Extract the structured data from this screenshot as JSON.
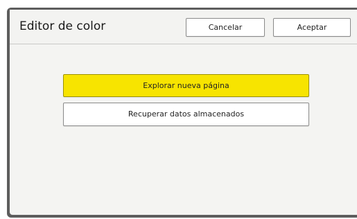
{
  "dialog": {
    "title": "Editor de color",
    "cancel_label": "Cancelar",
    "accept_label": "Aceptar"
  },
  "options": {
    "explore_label": "Explorar nueva página",
    "recover_label": "Recuperar datos almacenados"
  },
  "colors": {
    "highlight": "#f7e400",
    "panel_background": "#f4f4f2",
    "bezel": "#5d5d5d"
  }
}
